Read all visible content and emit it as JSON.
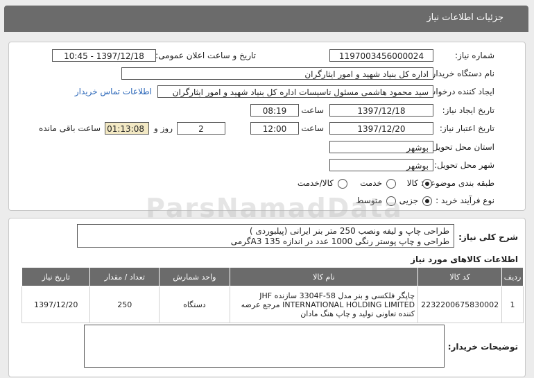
{
  "header": {
    "title": "جزئیات اطلاعات نیاز"
  },
  "form": {
    "need_number_label": "شماره نیاز:",
    "need_number": "1197003456000024",
    "announce_label": "تاریخ و ساعت اعلان عمومی:",
    "announce_value": "1397/12/18 - 10:45",
    "buyer_label": "نام دستگاه خریدار:",
    "buyer_value": "اداره کل بنیاد شهید و امور ایثارگران",
    "requester_label": "ایجاد کننده درخواست:",
    "requester_value": "سید محمود هاشمی مسئول تاسیسات اداره کل بنیاد شهید و امور ایثارگران",
    "contact_link": "اطلاعات تماس خریدار",
    "created_label": "تاریخ ایجاد نیاز:",
    "created_date": "1397/12/18",
    "time_label": "ساعت",
    "created_time": "08:19",
    "validity_label": "تاریخ اعتبار نیاز:",
    "validity_date": "1397/12/20",
    "validity_time": "12:00",
    "day_label": "روز و",
    "days": "2",
    "remaining_time": "01:13:08",
    "remaining_label": "ساعت باقی مانده",
    "province_label": "استان محل تحویل:",
    "province_value": "بوشهر",
    "city_label": "شهر محل تحویل:",
    "city_value": "بوشهر",
    "category_label": "طبقه بندی موضوعی:",
    "category_options": [
      "کالا",
      "خدمت",
      "کالا/خدمت"
    ],
    "category_selected": "کالا",
    "process_label": "نوع فرآیند خرید :",
    "process_options": [
      "جزیی",
      "متوسط"
    ],
    "process_selected": "جزیی"
  },
  "summary": {
    "label": "شرح کلی نیاز:",
    "line1": "طراحی چاپ و لیفه ونصب 250 متر بنر ایرانی (پیلبوردی )",
    "line2": "طراحی و چاپ پوستر رنگی 1000 عدد در اندازه 135  A3گرمی"
  },
  "goods": {
    "title": "اطلاعات کالاهای مورد نیاز",
    "columns": [
      "ردیف",
      "کد کالا",
      "نام کالا",
      "واحد شمارش",
      "تعداد / مقدار",
      "تاریخ نیاز"
    ],
    "rows": [
      {
        "row": "1",
        "code": "2232200675830002",
        "name": "چاپگر فلکسی و بنر مدل 3304F-58 سازنده JHF INTERNATIONAL HOLDING LIMITED مرجع عرضه کننده تعاونی تولید و چاپ هنگ مادان",
        "unit": "دستگاه",
        "qty": "250",
        "date": "1397/12/20"
      }
    ]
  },
  "buyer_notes": {
    "label": "توضیحات خریدار:",
    "value": ""
  },
  "watermark": {
    "text": "ParsNamadData"
  }
}
